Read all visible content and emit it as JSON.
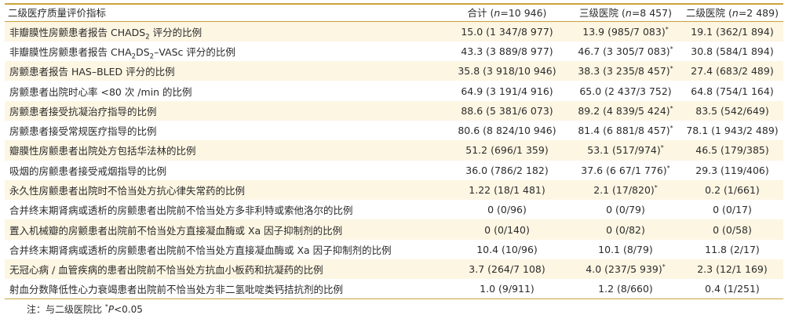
{
  "header": {
    "col_indicator": "二级医疗质量评价指标",
    "col_total_pre": "合计 (",
    "col_total_n": "n",
    "col_total_post": "=10 946)",
    "col_tertiary_pre": "三级医院 (",
    "col_tertiary_n": "n",
    "col_tertiary_post": "=8 457)",
    "col_secondary_pre": "二级医院 (",
    "col_secondary_n": "n",
    "col_secondary_post": "=2 489)"
  },
  "rows": [
    {
      "name_pre": "非瓣膜性房颤患者报告 CHADS",
      "name_sub": "2",
      "name_post": " 评分的比例",
      "total": "15.0 (1 347/8 977)",
      "tertiary": "13.9 (985/7 083)",
      "tertiary_star": "*",
      "secondary": "19.1 (362/1 894)"
    },
    {
      "name_pre": "非瓣膜性房颤患者报告 CHA",
      "name_sub": "2",
      "name_mid": "DS",
      "name_sub2": "2",
      "name_post": "–VASc 评分的比例",
      "total": "43.3 (3 889/8 977)",
      "tertiary": "46.7 (3 305/7 083)",
      "tertiary_star": "*",
      "secondary": "30.8 (584/1 894)"
    },
    {
      "name": "房颤患者报告 HAS–BLED 评分的比例",
      "total": "35.8 (3 918/10 946)",
      "tertiary": "38.3 (3 235/8 457)",
      "tertiary_star": "*",
      "secondary": "27.4 (683/2 489)"
    },
    {
      "name": "房颤患者出院时心率 <80 次 /min 的比例",
      "total": "64.9 (3 191/4 916)",
      "tertiary": "65.0 (2 437/3 752)",
      "tertiary_star": "",
      "secondary": "64.8 (754/1 164)"
    },
    {
      "name": "房颤患者接受抗凝治疗指导的比例",
      "total": "88.6 (5 381/6 073)",
      "tertiary": "89.2 (4 839/5 424)",
      "tertiary_star": "*",
      "secondary": "83.5 (542/649)"
    },
    {
      "name": "房颤患者接受常规医疗指导的比例",
      "total": "80.6 (8 824/10 946)",
      "tertiary": "81.4 (6 881/8 457)",
      "tertiary_star": "*",
      "secondary": "78.1 (1 943/2 489)"
    },
    {
      "name": "瓣膜性房颤患者出院处方包括华法林的比例",
      "total": "51.2 (696/1 359)",
      "tertiary": "53.1 (517/974)",
      "tertiary_star": "*",
      "secondary": "46.5 (179/385)"
    },
    {
      "name": "吸烟的房颤患者接受戒烟指导的比例",
      "total": "36.0 (786/2 182)",
      "tertiary": "37.6 (6 67/1 776)",
      "tertiary_star": "*",
      "secondary": "29.3 (119/406)"
    },
    {
      "name": "永久性房颤患者出院时不恰当处方抗心律失常药的比例",
      "total": "1.22 (18/1 481)",
      "tertiary": "2.1 (17/820)",
      "tertiary_star": "*",
      "secondary": "0.2 (1/661)"
    },
    {
      "name": "合并终末期肾病或透析的房颤患者出院前不恰当处方多非利特或索他洛尔的比例",
      "total": "0 (0/96)",
      "tertiary": "0 (0/79)",
      "tertiary_star": "",
      "secondary": "0 (0/17)"
    },
    {
      "name": "置入机械瓣的房颤患者出院前不恰当处方直接凝血酶或 Xa 因子抑制剂的比例",
      "total": "0 (0/140)",
      "tertiary": "0 (0/82)",
      "tertiary_star": "",
      "secondary": "0 (0/58)"
    },
    {
      "name": "合并终末期肾病或透析的房颤患者出院前不恰当处方直接凝血酶或 Xa 因子抑制剂的比例",
      "total": "10.4 (10/96)",
      "tertiary": "10.1 (8/79)",
      "tertiary_star": "",
      "secondary": "11.8 (2/17)"
    },
    {
      "name": "无冠心病 / 血管疾病的患者出院前不恰当处方抗血小板药和抗凝药的比例",
      "total": "3.7 (264/7 108)",
      "tertiary": "4.0 (237/5 939)",
      "tertiary_star": "*",
      "secondary": "2.3 (12/1 169)"
    },
    {
      "name": "射血分数降低性心力衰竭患者出院前不恰当处方非二氢吡啶类钙拮抗剂的比例",
      "total": "1.0 (9/911)",
      "tertiary": "1.2 (8/660)",
      "tertiary_star": "",
      "secondary": "0.4 (1/251)"
    }
  ],
  "note": {
    "prefix": "注：与二级医院比 ",
    "star": "*",
    "p": "P",
    "suffix": "<0.05"
  },
  "colors": {
    "rule": "#c9a33a",
    "stripe": "#fdf6e3"
  }
}
